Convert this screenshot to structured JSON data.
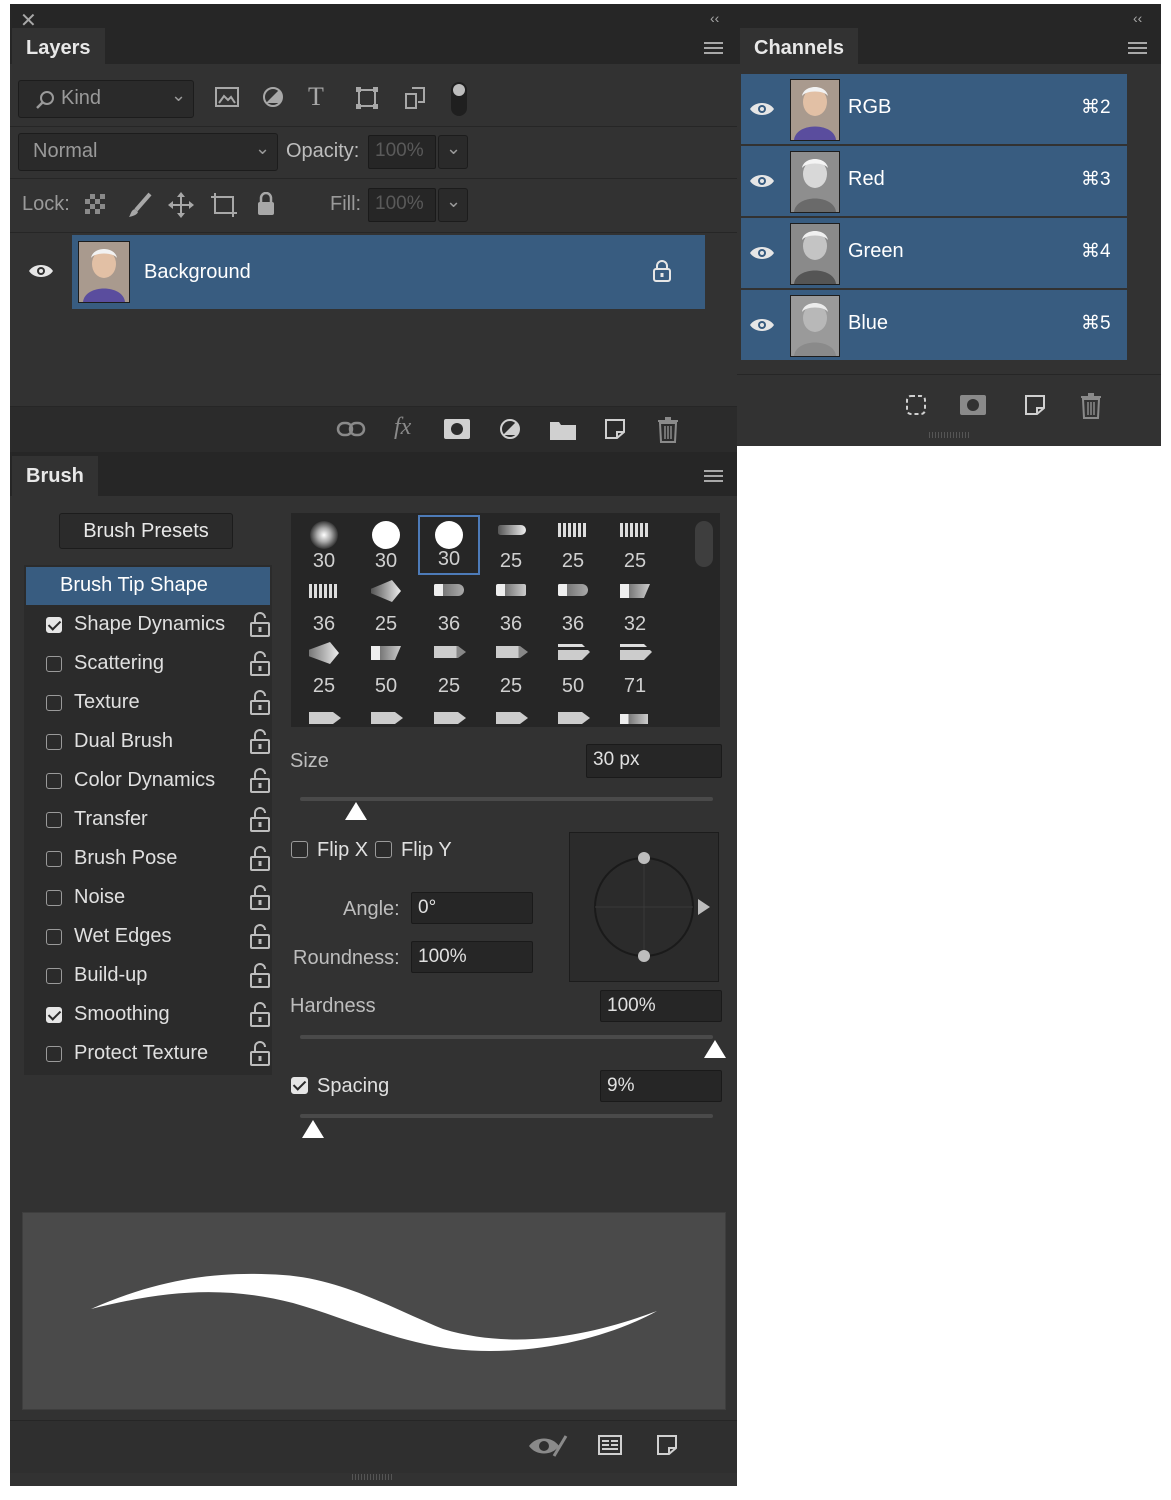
{
  "layers_panel": {
    "tab_label": "Layers",
    "filter": {
      "label": "Kind"
    },
    "blend_mode": "Normal",
    "opacity_label": "Opacity:",
    "opacity_value": "100%",
    "lock_label": "Lock:",
    "fill_label": "Fill:",
    "fill_value": "100%",
    "layers": [
      {
        "name": "Background",
        "locked": true,
        "visible": true
      }
    ]
  },
  "channels_panel": {
    "tab_label": "Channels",
    "channels": [
      {
        "name": "RGB",
        "shortcut": "⌘2"
      },
      {
        "name": "Red",
        "shortcut": "⌘3"
      },
      {
        "name": "Green",
        "shortcut": "⌘4"
      },
      {
        "name": "Blue",
        "shortcut": "⌘5"
      }
    ]
  },
  "brush_panel": {
    "tab_label": "Brush",
    "presets_button": "Brush Presets",
    "selected_option": "Brush Tip Shape",
    "options": [
      {
        "label": "Shape Dynamics",
        "checked": true
      },
      {
        "label": "Scattering",
        "checked": false
      },
      {
        "label": "Texture",
        "checked": false
      },
      {
        "label": "Dual Brush",
        "checked": false
      },
      {
        "label": "Color Dynamics",
        "checked": false
      },
      {
        "label": "Transfer",
        "checked": false
      },
      {
        "label": "Brush Pose",
        "checked": false
      },
      {
        "label": "Noise",
        "checked": false
      },
      {
        "label": "Wet Edges",
        "checked": false
      },
      {
        "label": "Build-up",
        "checked": false
      },
      {
        "label": "Smoothing",
        "checked": true
      },
      {
        "label": "Protect Texture",
        "checked": false
      }
    ],
    "tips": [
      [
        "30",
        "30",
        "30",
        "25",
        "25",
        "25"
      ],
      [
        "36",
        "25",
        "36",
        "36",
        "36",
        "32"
      ],
      [
        "25",
        "50",
        "25",
        "25",
        "50",
        "71"
      ]
    ],
    "size_label": "Size",
    "size_value": "30 px",
    "flip_x_label": "Flip X",
    "flip_y_label": "Flip Y",
    "angle_label": "Angle:",
    "angle_value": "0°",
    "roundness_label": "Roundness:",
    "roundness_value": "100%",
    "hardness_label": "Hardness",
    "hardness_value": "100%",
    "spacing_label": "Spacing",
    "spacing_value": "9%",
    "spacing_checked": true
  },
  "colors": {
    "panel_bg": "#323232",
    "selected_row": "#385c80",
    "title_bg": "#262626"
  }
}
